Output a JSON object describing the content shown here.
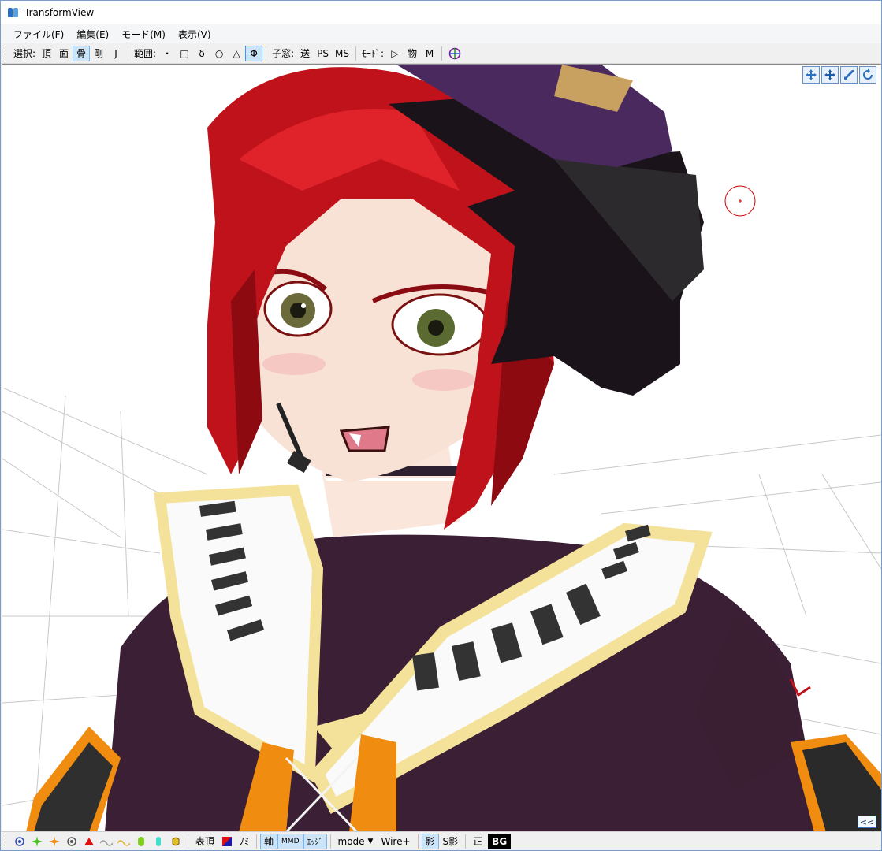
{
  "window": {
    "title": "TransformView"
  },
  "menubar": {
    "items": [
      "ファイル(F)",
      "編集(E)",
      "モード(M)",
      "表示(V)"
    ]
  },
  "toolbar": {
    "select_label": "選択:",
    "select_buttons": [
      "頂",
      "面",
      "骨",
      "剛",
      "J"
    ],
    "select_active_index": 2,
    "range_label": "範囲:",
    "range_buttons": [
      "・",
      "□",
      "δ",
      "○",
      "△",
      "Φ"
    ],
    "range_active_index": 5,
    "child_label": "子窓:",
    "child_buttons": [
      "送",
      "PS",
      "MS"
    ],
    "mode_label": "ﾓｰﾄﾞ:",
    "mode_buttons": [
      "▷",
      "物",
      "M"
    ],
    "target_icon": "crosshair-globe-icon"
  },
  "view_controls": [
    "move-view-icon",
    "pan-view-icon",
    "zoom-view-icon",
    "rotate-view-icon"
  ],
  "viewport": {
    "collapse_label": "<<"
  },
  "statusbar": {
    "icons": [
      "vertex-point-icon",
      "spark-green-icon",
      "spark-orange-icon",
      "circle-point-icon",
      "red-triangle-icon",
      "wave-gray-icon",
      "wave-yellow-icon",
      "green-capsule-icon",
      "cyan-capsule-icon",
      "yellow-cube-icon"
    ],
    "vertex_label": "表頂",
    "nomi_label": "ﾉﾐ",
    "axis_label": "軸",
    "mmd_label": "MMD",
    "edge_label": "ｴｯｼﾞ",
    "mode_label": "mode",
    "wire_label": "Wire+",
    "shadow_label": "影",
    "sshadow_label": "S影",
    "ortho_label": "正",
    "bg_label": "BG"
  },
  "colors": {
    "accent_active": "#cce4f7",
    "hair": "#c0121a",
    "hat": "#4a2a5e",
    "outfit": "#3a1f33",
    "trim": "#f4e29a",
    "orange": "#f08c10"
  }
}
